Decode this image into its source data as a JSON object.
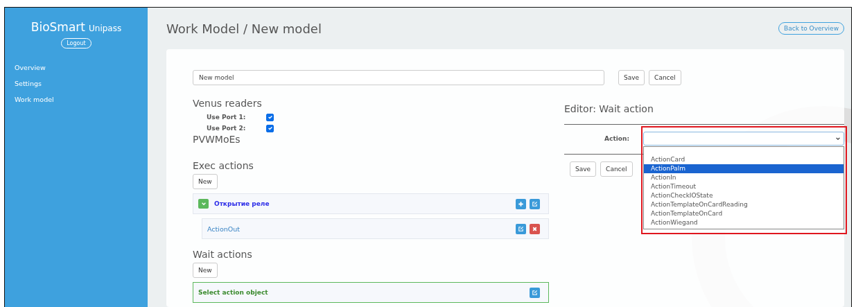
{
  "app": {
    "brand": "BioSmart",
    "product": "Unipass",
    "logout": "Logout"
  },
  "sidebar": {
    "items": [
      {
        "label": "Overview"
      },
      {
        "label": "Settings"
      },
      {
        "label": "Work model"
      }
    ]
  },
  "page": {
    "title": "Work Model / New model",
    "back_button": "Back to Overview"
  },
  "model_name": {
    "value": "New model"
  },
  "form_buttons": [
    "Save",
    "Cancel"
  ],
  "venus_readers": {
    "heading": "Venus readers",
    "ports": [
      {
        "label": "Use Port 1:",
        "checked": true
      },
      {
        "label": "Use Port 2:",
        "checked": true
      }
    ]
  },
  "pvwmoes": {
    "heading": "PVWMoEs"
  },
  "exec_actions": {
    "heading": "Exec actions",
    "new_button": "New",
    "items": [
      {
        "label": "Открытие реле",
        "expanded": true,
        "children": [
          {
            "label": "ActionOut"
          }
        ]
      }
    ]
  },
  "wait_actions": {
    "heading": "Wait actions",
    "new_button": "New",
    "items": [
      {
        "label": "Select action object",
        "selected": true
      }
    ]
  },
  "editor": {
    "heading": "Editor: Wait action",
    "field_label": "Action:",
    "options": [
      {
        "label": "ActionCard",
        "selected": false
      },
      {
        "label": "ActionPalm",
        "selected": true
      },
      {
        "label": "ActionIn",
        "selected": false
      },
      {
        "label": "ActionTimeout",
        "selected": false
      },
      {
        "label": "ActionCheckIOState",
        "selected": false
      },
      {
        "label": "ActionTemplateOnCardReading",
        "selected": false
      },
      {
        "label": "ActionTemplateOnCard",
        "selected": false
      },
      {
        "label": "ActionWiegand",
        "selected": false
      }
    ],
    "buttons": [
      "Save",
      "Cancel"
    ]
  }
}
